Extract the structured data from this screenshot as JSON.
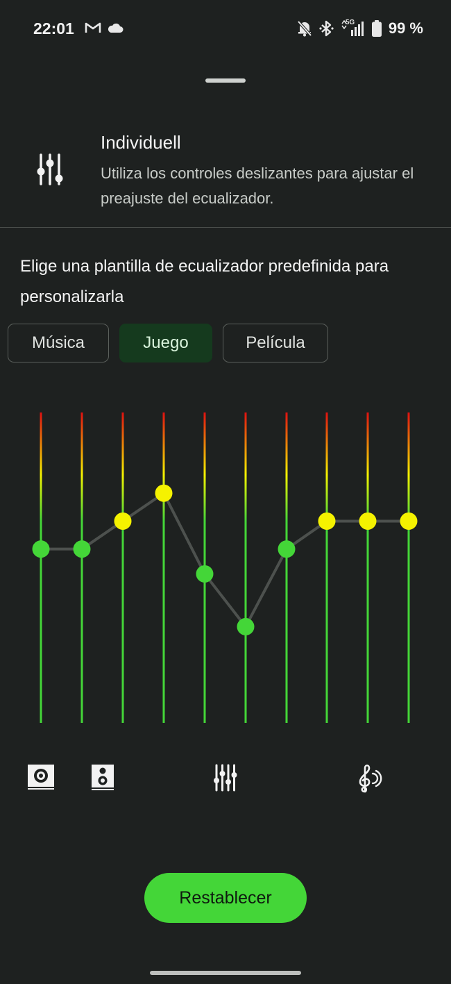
{
  "status": {
    "time": "22:01",
    "battery": "99 %",
    "network": "5G"
  },
  "preset": {
    "title": "Individuell",
    "description": "Utiliza los controles deslizantes para ajustar el preajuste del ecualizador."
  },
  "section_label": "Elige una plantilla de ecualizador predefinida para personalizarla",
  "chips": [
    {
      "label": "Música",
      "selected": false
    },
    {
      "label": "Juego",
      "selected": true
    },
    {
      "label": "Película",
      "selected": false
    }
  ],
  "equalizer": {
    "band_count": 10,
    "levels": [
      0.56,
      0.56,
      0.65,
      0.74,
      0.48,
      0.31,
      0.56,
      0.65,
      0.65,
      0.65
    ],
    "colors": {
      "low": "#44d638",
      "mid": "#f5f200",
      "high": "#e01010",
      "line": "#4d514e"
    }
  },
  "band_icons": [
    "subwoofer-icon",
    "speaker-icon",
    "equalizer-icon",
    "treble-clef-icon"
  ],
  "reset_label": "Restablecer"
}
